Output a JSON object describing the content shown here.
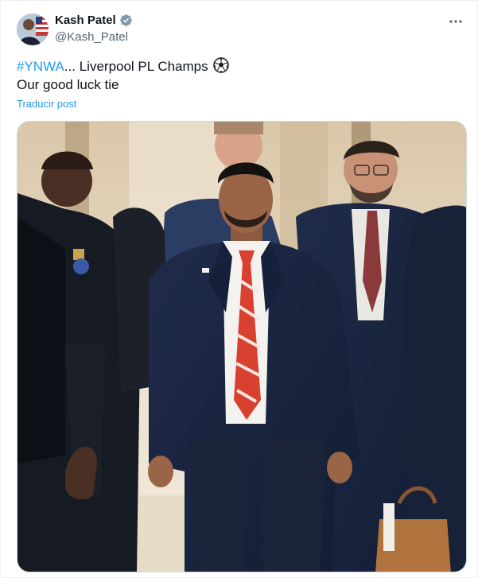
{
  "post": {
    "author": {
      "display_name": "Kash Patel",
      "handle": "@Kash_Patel",
      "verified": true
    },
    "text": {
      "hashtag": "#YNWA",
      "line1_rest": "... Liverpool PL Champs",
      "emoji": "soccer-ball",
      "line2": "Our good luck tie"
    },
    "translate_label": "Traducir post",
    "media": {
      "kind": "photo"
    }
  },
  "icons": {
    "verified": "verified-badge-icon",
    "more": "more-options-icon",
    "emoji": "soccer-ball-icon"
  },
  "colors": {
    "link": "#1d9bf0",
    "secondary_text": "#536471",
    "primary_text": "#0f1419",
    "tie_red": "#d8402f"
  }
}
